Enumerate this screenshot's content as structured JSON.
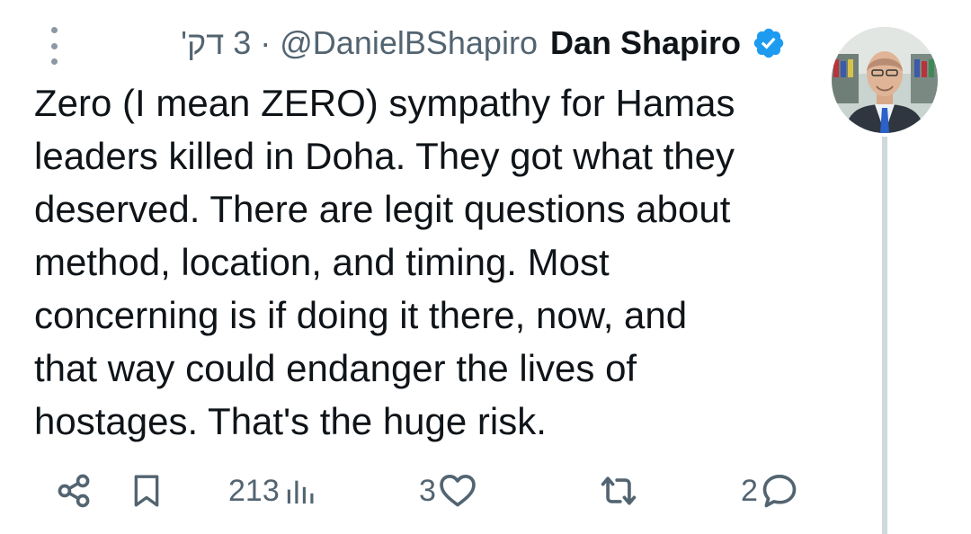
{
  "header": {
    "time": "3 דק'",
    "separator": "·",
    "handle": "@DanielBShapiro",
    "name": "Dan Shapiro",
    "verified_color": "#1d9bf0"
  },
  "tweet": {
    "text": "Zero (I mean ZERO) sympathy for Hamas\nleaders killed in Doha. They got what they\ndeserved. There are legit questions about\nmethod, location, and timing. Most\nconcerning is if doing it there, now, and\nthat way could endanger the lives of\nhostages. That's the huge risk."
  },
  "actions": {
    "views": "213",
    "likes": "3",
    "retweets": "",
    "replies": "2"
  },
  "icons": [
    "more-icon",
    "verified-icon",
    "share-icon",
    "bookmark-icon",
    "views-icon",
    "heart-icon",
    "retweet-icon",
    "reply-icon"
  ]
}
